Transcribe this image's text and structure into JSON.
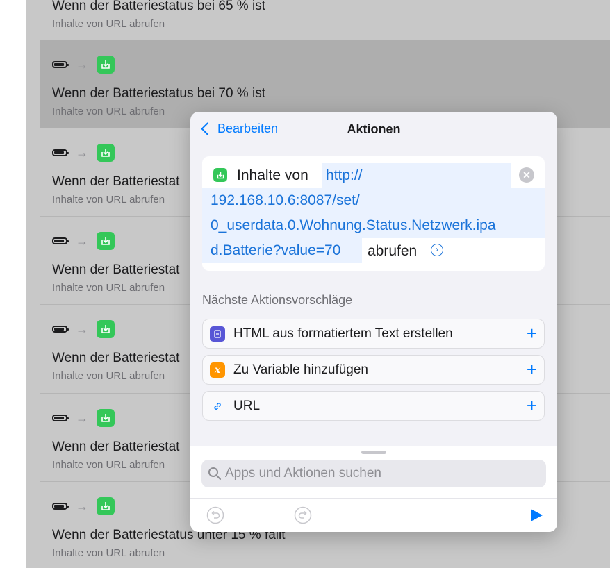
{
  "background_list": [
    {
      "title": "Wenn der Batteriestatus bei 65 % ist",
      "subtitle": "Inhalte von URL abrufen"
    },
    {
      "title": "Wenn der Batteriestatus bei 70 % ist",
      "subtitle": "Inhalte von URL abrufen"
    },
    {
      "title": "Wenn der Batteriestat",
      "subtitle": "Inhalte von URL abrufen"
    },
    {
      "title": "Wenn der Batteriestat",
      "subtitle": "Inhalte von URL abrufen"
    },
    {
      "title": "Wenn der Batteriestat",
      "subtitle": "Inhalte von URL abrufen"
    },
    {
      "title": "Wenn der Batteriestat",
      "subtitle": "Inhalte von URL abrufen"
    },
    {
      "title": "Wenn der Batteriestatus unter 15 % fällt",
      "subtitle": "Inhalte von URL abrufen"
    }
  ],
  "modal": {
    "back_label": "Bearbeiten",
    "title": "Aktionen",
    "action": {
      "prefix": "Inhalte von",
      "url_lines": [
        "http://",
        "192.168.10.6:8087/set/",
        "0_userdata.0.Wohnung.Status.Netzwerk.ipa",
        "d.Batterie?value=70"
      ],
      "suffix": "abrufen"
    },
    "suggestions_label": "Nächste Aktionsvorschläge",
    "suggestions": [
      {
        "label": "HTML aus formatiertem Text erstellen",
        "icon": "html-icon",
        "color": "#5856d6"
      },
      {
        "label": "Zu Variable hinzufügen",
        "icon": "variable-icon",
        "color": "#ff9500"
      },
      {
        "label": "URL",
        "icon": "link-icon",
        "color": "#007aff"
      }
    ],
    "search_placeholder": "Apps und Aktionen suchen"
  }
}
